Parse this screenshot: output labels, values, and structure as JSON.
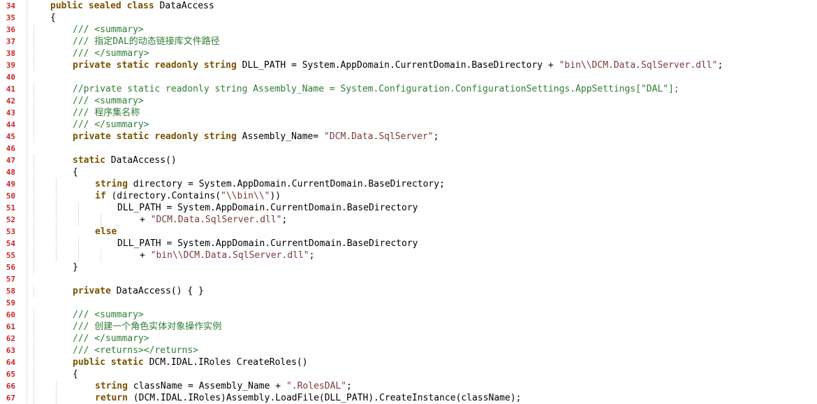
{
  "editor": {
    "lines": [
      {
        "num": "34",
        "indent": 1,
        "parts": [
          {
            "t": "kw",
            "v": "public sealed class "
          },
          {
            "t": "ty",
            "v": "DataAccess"
          }
        ]
      },
      {
        "num": "35",
        "indent": 1,
        "parts": [
          {
            "t": "ty",
            "v": "{"
          }
        ]
      },
      {
        "num": "36",
        "indent": 2,
        "parts": [
          {
            "t": "cm",
            "v": "/// <summary>"
          }
        ]
      },
      {
        "num": "37",
        "indent": 2,
        "parts": [
          {
            "t": "cm",
            "v": "/// 指定DAL的动态链接库文件路径"
          }
        ]
      },
      {
        "num": "38",
        "indent": 2,
        "parts": [
          {
            "t": "cm",
            "v": "/// </summary>"
          }
        ]
      },
      {
        "num": "39",
        "indent": 2,
        "parts": [
          {
            "t": "kw",
            "v": "private static readonly string "
          },
          {
            "t": "ty",
            "v": "DLL_PATH = System.AppDomain.CurrentDomain.BaseDirectory + "
          },
          {
            "t": "st",
            "v": "\"bin\\\\DCM.Data.SqlServer.dll\""
          },
          {
            "t": "ty",
            "v": ";"
          }
        ]
      },
      {
        "num": "40",
        "indent": 0,
        "parts": []
      },
      {
        "num": "41",
        "indent": 2,
        "parts": [
          {
            "t": "cm",
            "v": "//private static readonly string Assembly_Name = System.Configuration.ConfigurationSettings.AppSettings[\"DAL\"];"
          }
        ]
      },
      {
        "num": "42",
        "indent": 2,
        "parts": [
          {
            "t": "cm",
            "v": "/// <summary>"
          }
        ]
      },
      {
        "num": "43",
        "indent": 2,
        "parts": [
          {
            "t": "cm",
            "v": "/// 程序集名称"
          }
        ]
      },
      {
        "num": "44",
        "indent": 2,
        "parts": [
          {
            "t": "cm",
            "v": "/// </summary>"
          }
        ]
      },
      {
        "num": "45",
        "indent": 2,
        "parts": [
          {
            "t": "kw",
            "v": "private static readonly string "
          },
          {
            "t": "ty",
            "v": "Assembly_Name= "
          },
          {
            "t": "st",
            "v": "\"DCM.Data.SqlServer\""
          },
          {
            "t": "ty",
            "v": ";"
          }
        ]
      },
      {
        "num": "46",
        "indent": 0,
        "parts": []
      },
      {
        "num": "47",
        "indent": 2,
        "parts": [
          {
            "t": "kw",
            "v": "static "
          },
          {
            "t": "ty",
            "v": "DataAccess()"
          }
        ]
      },
      {
        "num": "48",
        "indent": 2,
        "parts": [
          {
            "t": "ty",
            "v": "{"
          }
        ]
      },
      {
        "num": "49",
        "indent": 3,
        "parts": [
          {
            "t": "kw",
            "v": "string "
          },
          {
            "t": "ty",
            "v": "directory = System.AppDomain.CurrentDomain.BaseDirectory;"
          }
        ]
      },
      {
        "num": "50",
        "indent": 3,
        "parts": [
          {
            "t": "kw",
            "v": "if "
          },
          {
            "t": "ty",
            "v": "(directory.Contains("
          },
          {
            "t": "st",
            "v": "\"\\\\bin\\\\\""
          },
          {
            "t": "ty",
            "v": "))"
          }
        ]
      },
      {
        "num": "51",
        "indent": 4,
        "parts": [
          {
            "t": "ty",
            "v": "DLL_PATH = System.AppDomain.CurrentDomain.BaseDirectory"
          }
        ]
      },
      {
        "num": "52",
        "indent": 5,
        "parts": [
          {
            "t": "ty",
            "v": "+ "
          },
          {
            "t": "st",
            "v": "\"DCM.Data.SqlServer.dll\""
          },
          {
            "t": "ty",
            "v": ";"
          }
        ]
      },
      {
        "num": "53",
        "indent": 3,
        "parts": [
          {
            "t": "kw",
            "v": "else"
          }
        ]
      },
      {
        "num": "54",
        "indent": 4,
        "parts": [
          {
            "t": "ty",
            "v": "DLL_PATH = System.AppDomain.CurrentDomain.BaseDirectory"
          }
        ]
      },
      {
        "num": "55",
        "indent": 5,
        "parts": [
          {
            "t": "ty",
            "v": "+ "
          },
          {
            "t": "st",
            "v": "\"bin\\\\DCM.Data.SqlServer.dll\""
          },
          {
            "t": "ty",
            "v": ";"
          }
        ]
      },
      {
        "num": "56",
        "indent": 2,
        "parts": [
          {
            "t": "ty",
            "v": "}"
          }
        ]
      },
      {
        "num": "57",
        "indent": 0,
        "parts": []
      },
      {
        "num": "58",
        "indent": 2,
        "parts": [
          {
            "t": "kw",
            "v": "private "
          },
          {
            "t": "ty",
            "v": "DataAccess() { }"
          }
        ]
      },
      {
        "num": "59",
        "indent": 0,
        "parts": []
      },
      {
        "num": "60",
        "indent": 2,
        "parts": [
          {
            "t": "cm",
            "v": "/// <summary>"
          }
        ]
      },
      {
        "num": "61",
        "indent": 2,
        "parts": [
          {
            "t": "cm",
            "v": "/// 创建一个角色实体对象操作实例"
          }
        ]
      },
      {
        "num": "62",
        "indent": 2,
        "parts": [
          {
            "t": "cm",
            "v": "/// </summary>"
          }
        ]
      },
      {
        "num": "63",
        "indent": 2,
        "parts": [
          {
            "t": "cm",
            "v": "/// <returns></returns>"
          }
        ]
      },
      {
        "num": "64",
        "indent": 2,
        "parts": [
          {
            "t": "kw",
            "v": "public static "
          },
          {
            "t": "ty",
            "v": "DCM.IDAL.IRoles CreateRoles()"
          }
        ]
      },
      {
        "num": "65",
        "indent": 2,
        "parts": [
          {
            "t": "ty",
            "v": "{"
          }
        ]
      },
      {
        "num": "66",
        "indent": 3,
        "parts": [
          {
            "t": "kw",
            "v": "string "
          },
          {
            "t": "ty",
            "v": "className = Assembly_Name + "
          },
          {
            "t": "st",
            "v": "\".RolesDAL\""
          },
          {
            "t": "ty",
            "v": ";"
          }
        ]
      },
      {
        "num": "67",
        "indent": 3,
        "parts": [
          {
            "t": "kw",
            "v": "return "
          },
          {
            "t": "ty",
            "v": "(DCM.IDAL.IRoles)Assembly.LoadFile(DLL_PATH).CreateInstance(className);"
          }
        ]
      }
    ]
  }
}
